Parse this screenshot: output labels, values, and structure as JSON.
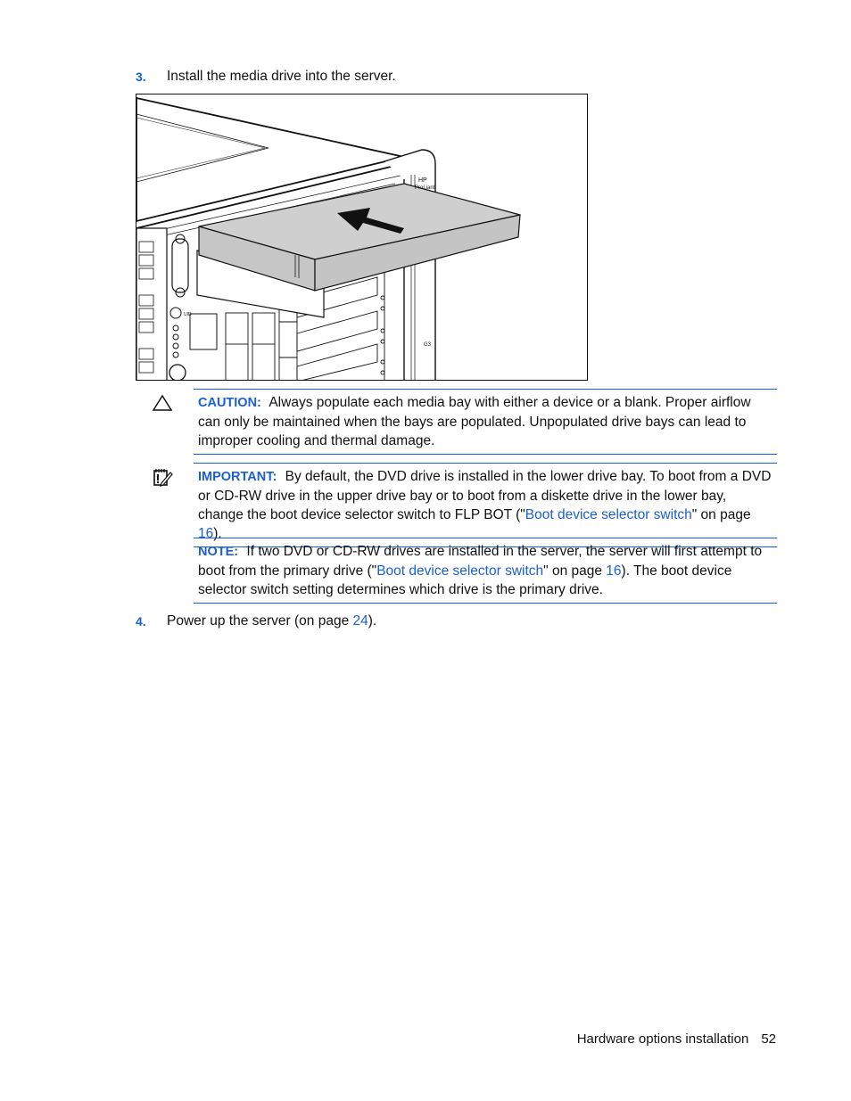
{
  "steps": [
    {
      "number": "3.",
      "text": "Install the media drive into the server."
    },
    {
      "number": "4.",
      "text_before": "Power up the server (on page ",
      "link": "24",
      "text_after": ")."
    }
  ],
  "figure": {
    "alt": "Media drive being slid into upper media bay of server",
    "bezel_label_line1": "HP",
    "bezel_label_line2": "ProLiant",
    "side_label": "G3",
    "uid_label": "UID",
    "fill_gray": "#cfcfcf"
  },
  "caution": {
    "icon": "warning-triangle-icon",
    "label": "CAUTION:",
    "text": "Always populate each media bay with either a device or a blank. Proper airflow can only be maintained when the bays are populated. Unpopulated drive bays can lead to improper cooling and thermal damage."
  },
  "important": {
    "icon": "notepad-important-icon",
    "label": "IMPORTANT:",
    "text_before": "By default, the DVD drive is installed in the lower drive bay. To boot from a DVD or CD-RW drive in the upper drive bay or to boot from a diskette drive in the lower bay, change the boot device selector switch to FLP BOT (\"",
    "link_text": "Boot device selector switch",
    "text_mid": "\" on page ",
    "page_link": "16",
    "text_after": ")."
  },
  "note": {
    "label": "NOTE:",
    "text_before": "If two DVD or CD-RW drives are installed in the server, the server will first attempt to boot from the primary drive (\"",
    "link_text": "Boot device selector switch",
    "text_mid": "\" on page ",
    "page_link": "16",
    "text_after": "). The boot device selector switch setting determines which drive is the primary drive."
  },
  "footer": {
    "section": "Hardware options installation",
    "page_number": "52"
  },
  "colors": {
    "accent": "#1a5fd6",
    "rule": "#1a5fd6",
    "text": "#111111"
  }
}
